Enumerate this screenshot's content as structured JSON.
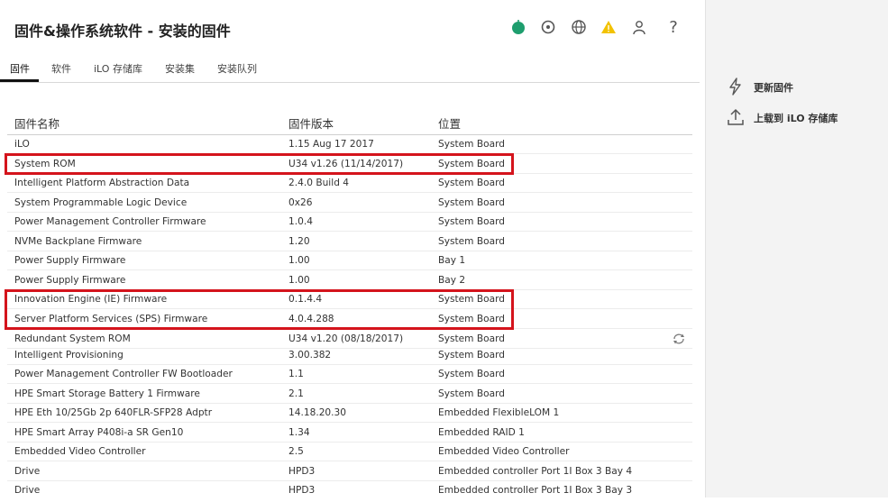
{
  "header": {
    "title": "固件&操作系统软件 - 安装的固件",
    "icons": [
      "health-ok-icon",
      "location-icon",
      "language-icon",
      "warning-icon",
      "user-icon",
      "help-icon"
    ],
    "help_label": "?"
  },
  "tabs": [
    {
      "label": "固件",
      "active": true
    },
    {
      "label": "软件"
    },
    {
      "label": "iLO 存储库"
    },
    {
      "label": "安装集"
    },
    {
      "label": "安装队列"
    }
  ],
  "table": {
    "columns": [
      "固件名称",
      "固件版本",
      "位置"
    ],
    "rows": [
      [
        "iLO",
        "1.15 Aug 17 2017",
        "System Board"
      ],
      [
        "System ROM",
        "U34 v1.26 (11/14/2017)",
        "System Board"
      ],
      [
        "Intelligent Platform Abstraction Data",
        "2.4.0 Build 4",
        "System Board"
      ],
      [
        "System Programmable Logic Device",
        "0x26",
        "System Board"
      ],
      [
        "Power Management Controller Firmware",
        "1.0.4",
        "System Board"
      ],
      [
        "NVMe Backplane Firmware",
        "1.20",
        "System Board"
      ],
      [
        "Power Supply Firmware",
        "1.00",
        "Bay 1"
      ],
      [
        "Power Supply Firmware",
        "1.00",
        "Bay 2"
      ],
      [
        "Innovation Engine (IE) Firmware",
        "0.1.4.4",
        "System Board"
      ],
      [
        "Server Platform Services (SPS) Firmware",
        "4.0.4.288",
        "System Board"
      ],
      [
        "Redundant System ROM",
        "U34 v1.20 (08/18/2017)",
        "System Board"
      ],
      [
        "Intelligent Provisioning",
        "3.00.382",
        "System Board"
      ],
      [
        "Power Management Controller FW Bootloader",
        "1.1",
        "System Board"
      ],
      [
        "HPE Smart Storage Battery 1 Firmware",
        "2.1",
        "System Board"
      ],
      [
        "HPE Eth 10/25Gb 2p 640FLR-SFP28 Adptr",
        "14.18.20.30",
        "Embedded FlexibleLOM 1"
      ],
      [
        "HPE Smart Array P408i-a SR Gen10",
        "1.34",
        "Embedded RAID 1"
      ],
      [
        "Embedded Video Controller",
        "2.5",
        "Embedded Video Controller"
      ],
      [
        "Drive",
        "HPD3",
        "Embedded controller Port 1I Box 3 Bay 4"
      ],
      [
        "Drive",
        "HPD3",
        "Embedded controller Port 1I Box 3 Bay 3"
      ]
    ]
  },
  "actions": [
    {
      "label": "更新固件",
      "icon": "lightning-icon"
    },
    {
      "label": "上载到 iLO 存储库",
      "icon": "upload-icon"
    }
  ],
  "colors": {
    "highlight": "#d4141c",
    "health_ok": "#1e9e6e",
    "warning": "#f2c200"
  }
}
